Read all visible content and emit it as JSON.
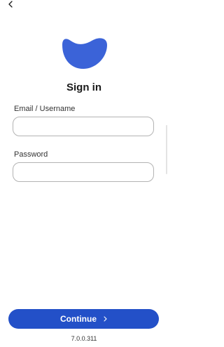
{
  "header": {
    "back_icon": "chevron-left-icon"
  },
  "brand": {
    "logo_icon": "blue-blob-logo",
    "logo_color": "#3b63d8"
  },
  "page": {
    "title": "Sign in"
  },
  "form": {
    "email": {
      "label": "Email / Username",
      "value": "",
      "placeholder": ""
    },
    "password": {
      "label": "Password",
      "value": "",
      "placeholder": ""
    }
  },
  "actions": {
    "continue_label": "Continue",
    "continue_icon": "chevron-right-icon",
    "accent_color": "#2350c8"
  },
  "footer": {
    "version": "7.0.0.311"
  }
}
